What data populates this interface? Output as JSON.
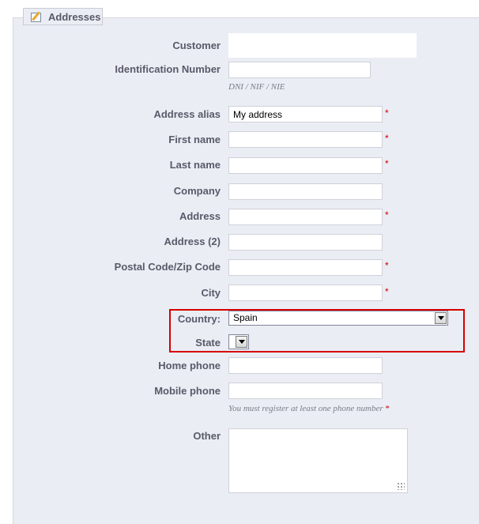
{
  "section": {
    "title": "Addresses",
    "icon": "edit-icon"
  },
  "fields": {
    "customer": {
      "label": "Customer",
      "value": ""
    },
    "identification": {
      "label": "Identification Number",
      "value": "",
      "hint": "DNI / NIF / NIE"
    },
    "alias": {
      "label": "Address alias",
      "value": "My address",
      "required": "*"
    },
    "firstname": {
      "label": "First name",
      "value": "",
      "required": "*"
    },
    "lastname": {
      "label": "Last name",
      "value": "",
      "required": "*"
    },
    "company": {
      "label": "Company",
      "value": ""
    },
    "address1": {
      "label": "Address",
      "value": "",
      "required": "*"
    },
    "address2": {
      "label": "Address (2)",
      "value": ""
    },
    "postcode": {
      "label": "Postal Code/Zip Code",
      "value": "",
      "required": "*"
    },
    "city": {
      "label": "City",
      "value": "",
      "required": "*"
    },
    "country": {
      "label": "Country:",
      "value": "Spain"
    },
    "state": {
      "label": "State",
      "value": ""
    },
    "phone": {
      "label": "Home phone",
      "value": ""
    },
    "mobile": {
      "label": "Mobile phone",
      "value": "",
      "hint": "You must register at least one phone number",
      "required": "*"
    },
    "other": {
      "label": "Other",
      "value": ""
    }
  },
  "colors": {
    "highlight": "#d40000",
    "required": "#cc0000",
    "panel": "#ebedf4"
  }
}
